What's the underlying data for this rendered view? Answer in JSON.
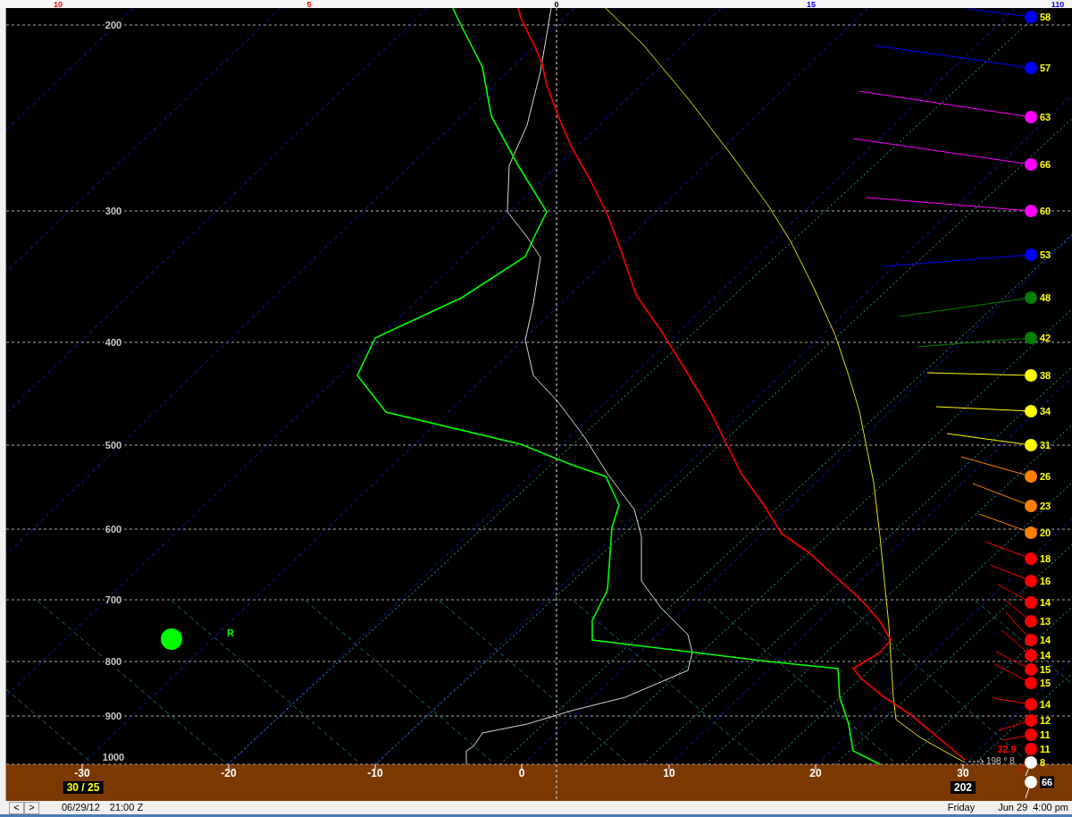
{
  "header_labels": [
    {
      "text": "10",
      "color": "#ff0000"
    },
    {
      "text": "5",
      "color": "#ff0000"
    },
    {
      "text": "0",
      "color": "#000000"
    },
    {
      "text": "15",
      "color": "#0000ff"
    },
    {
      "text": "110",
      "color": "#0000ff"
    }
  ],
  "chart": {
    "pressure_labels": [
      "200",
      "300",
      "400",
      "500",
      "600",
      "700",
      "800",
      "900",
      "1000"
    ],
    "marker": {
      "label": "R"
    },
    "surface": {
      "temperature": "32.9",
      "wind": "198 ° 8"
    }
  },
  "winds": [
    {
      "speed": "58",
      "color": "#0000ff",
      "boxed": false
    },
    {
      "speed": "57",
      "color": "#0000ff",
      "boxed": false
    },
    {
      "speed": "63",
      "color": "#ff00ff",
      "boxed": false
    },
    {
      "speed": "66",
      "color": "#ff00ff",
      "boxed": false
    },
    {
      "speed": "60",
      "color": "#ff00ff",
      "boxed": false
    },
    {
      "speed": "53",
      "color": "#0000ff",
      "boxed": false
    },
    {
      "speed": "48",
      "color": "#008000",
      "boxed": false
    },
    {
      "speed": "42",
      "color": "#008000",
      "boxed": false
    },
    {
      "speed": "38",
      "color": "#ffff00",
      "boxed": false
    },
    {
      "speed": "34",
      "color": "#ffff00",
      "boxed": false
    },
    {
      "speed": "31",
      "color": "#ffff00",
      "boxed": false
    },
    {
      "speed": "26",
      "color": "#ff8000",
      "boxed": false
    },
    {
      "speed": "23",
      "color": "#ff8000",
      "boxed": false
    },
    {
      "speed": "20",
      "color": "#ff8000",
      "boxed": false
    },
    {
      "speed": "18",
      "color": "#ff0000",
      "boxed": false
    },
    {
      "speed": "16",
      "color": "#ff0000",
      "boxed": false
    },
    {
      "speed": "14",
      "color": "#ff0000",
      "boxed": false
    },
    {
      "speed": "13",
      "color": "#ff0000",
      "boxed": false
    },
    {
      "speed": "14",
      "color": "#ff0000",
      "boxed": false
    },
    {
      "speed": "14",
      "color": "#ff0000",
      "boxed": false
    },
    {
      "speed": "15",
      "color": "#ff0000",
      "boxed": false
    },
    {
      "speed": "15",
      "color": "#ff0000",
      "boxed": false
    },
    {
      "speed": "14",
      "color": "#ff0000",
      "boxed": false
    },
    {
      "speed": "12",
      "color": "#ff0000",
      "boxed": false
    },
    {
      "speed": "11",
      "color": "#ff0000",
      "boxed": false
    },
    {
      "speed": "11",
      "color": "#ff0000",
      "boxed": false
    },
    {
      "speed": "8",
      "color": "#ffffff",
      "boxed": false
    },
    {
      "speed": "66",
      "color": "#ffffff",
      "boxed": true
    }
  ],
  "axis_bar": {
    "temperature_labels": [
      "-30",
      "-20",
      "-10",
      "0",
      "10",
      "20",
      "30"
    ],
    "left_readout": "30 / 25",
    "right_readout": "202"
  },
  "status_bar": {
    "nav": [
      "<",
      ">"
    ],
    "date": "06/29/12",
    "time": "21:00 Z",
    "day": "Friday",
    "local_date": "Jun 29",
    "local_time": "4:00 pm"
  }
}
